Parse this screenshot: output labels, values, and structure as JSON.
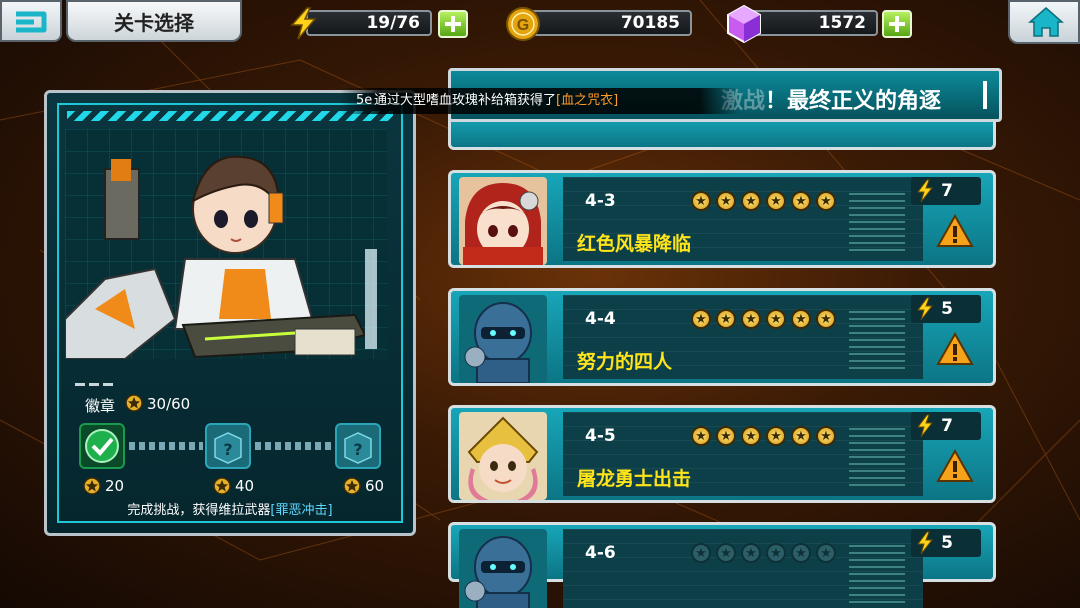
{
  "topbar": {
    "title": "关卡选择",
    "energy": "19/76",
    "gold": "70185",
    "gems": "1572",
    "colors": {
      "energy": "#ffd21a",
      "gold": "#e5a510",
      "gem": "#c85cf0",
      "plus": "#6cc21e"
    }
  },
  "notice": {
    "prefix": "5e",
    "text": "通过大型嗜血玫瑰补给箱获得了",
    "item": "[血之咒衣]"
  },
  "chapter": {
    "title_faded": "激战",
    "title": "！最终正义的角逐"
  },
  "left_panel": {
    "badge_label": "徽章",
    "badge_count": "30/60",
    "milestones": [
      "20",
      "40",
      "60"
    ],
    "reward_prefix": "完成挑战，获得维拉武器",
    "reward_weapon": "[罪恶冲击]"
  },
  "levels": [
    {
      "code": "4-3",
      "name": "红色风暴降临",
      "cost": "7",
      "stars_earned": 6,
      "stars_total": 6,
      "portrait": "red-hair-girl"
    },
    {
      "code": "4-4",
      "name": "努力的四人",
      "cost": "5",
      "stars_earned": 6,
      "stars_total": 6,
      "portrait": "armored-robot"
    },
    {
      "code": "4-5",
      "name": "屠龙勇士出击",
      "cost": "7",
      "stars_earned": 6,
      "stars_total": 6,
      "portrait": "gold-helmet-warrior"
    },
    {
      "code": "4-6",
      "name": "",
      "cost": "5",
      "stars_earned": 0,
      "stars_total": 6,
      "portrait": "armored-robot"
    }
  ]
}
